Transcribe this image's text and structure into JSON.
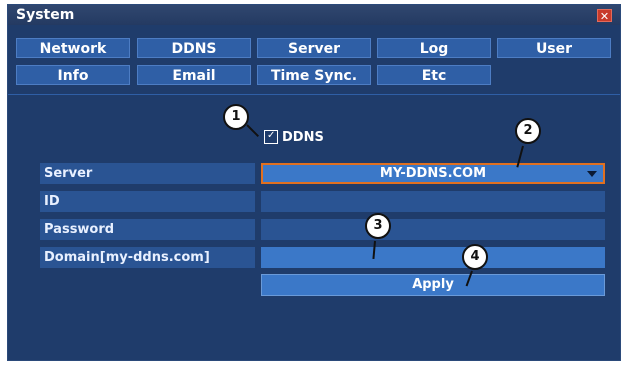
{
  "window": {
    "title": "System"
  },
  "tabs": [
    [
      "Network",
      "DDNS",
      "Server",
      "Log",
      "User"
    ],
    [
      "Info",
      "Email",
      "Time Sync.",
      "Etc"
    ]
  ],
  "ddns": {
    "checkbox_label": "DDNS",
    "checked": true,
    "fields": {
      "server": {
        "label": "Server",
        "value": "MY-DDNS.COM"
      },
      "id": {
        "label": "ID",
        "value": ""
      },
      "password": {
        "label": "Password",
        "value": ""
      },
      "domain": {
        "label": "Domain[my-ddns.com]",
        "value": ""
      }
    },
    "apply_label": "Apply"
  },
  "callouts": [
    "1",
    "2",
    "3",
    "4"
  ],
  "colors": {
    "accent": "#e07020",
    "panel": "#1f3c6b",
    "button": "#3b78c8"
  }
}
